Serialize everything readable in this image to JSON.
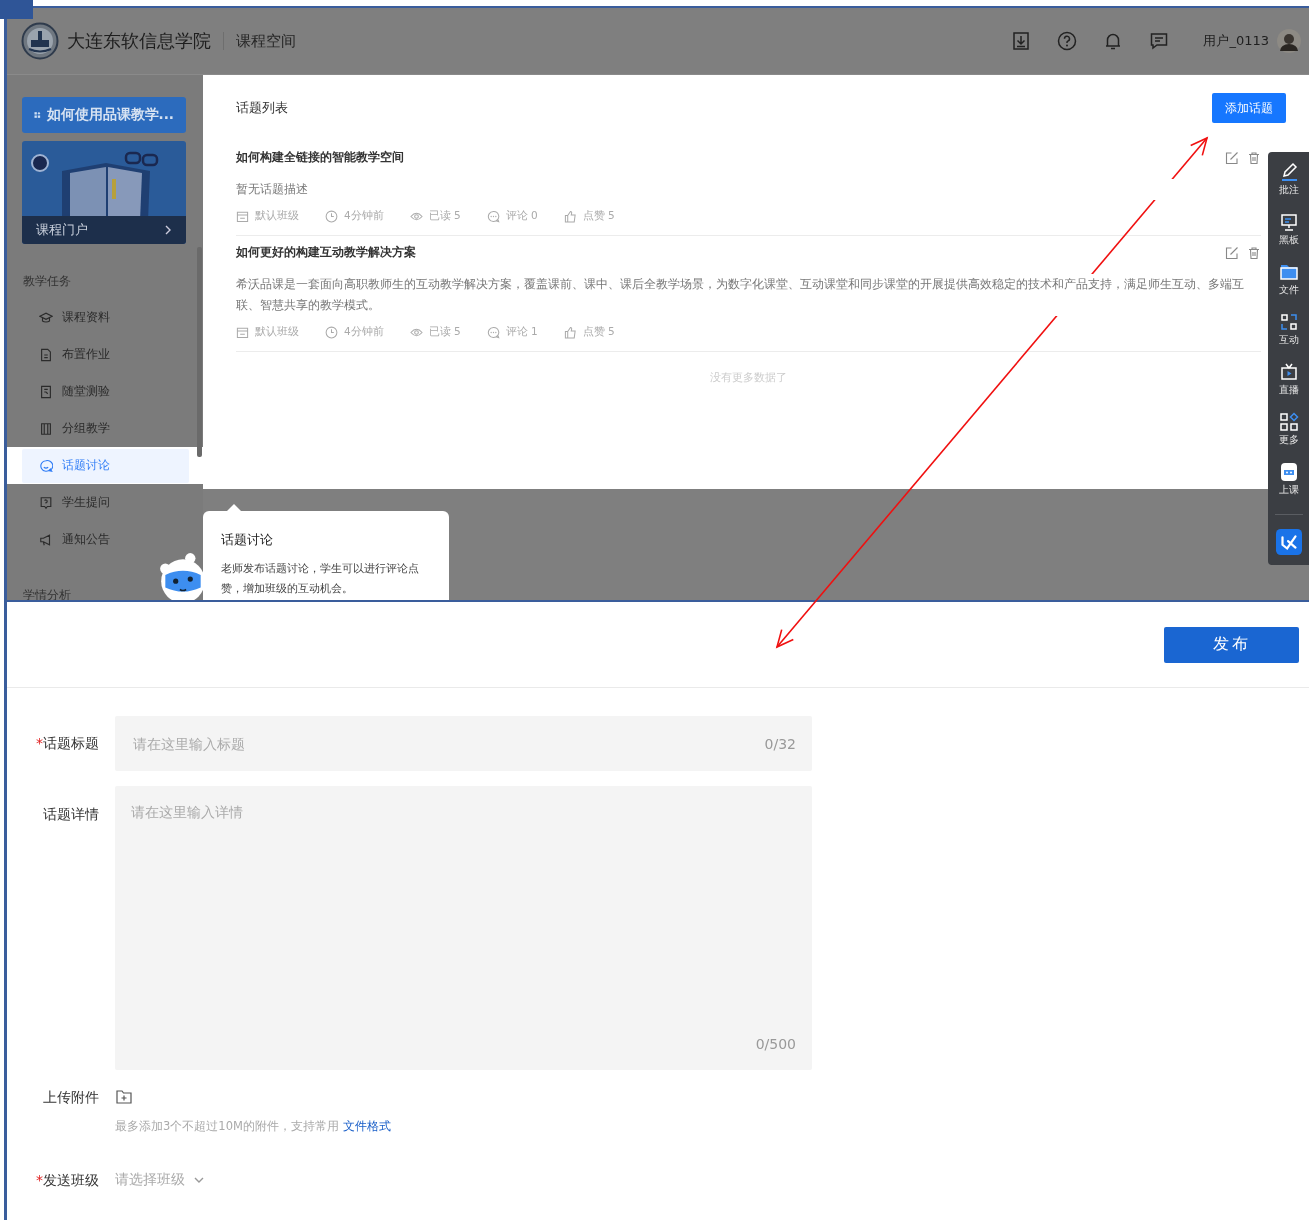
{
  "header": {
    "school": "大连东软信息学院",
    "section": "课程空间",
    "user": "用户_0113"
  },
  "sidebar": {
    "guide_button": "如何使用品课教学...",
    "portal": "课程门户",
    "groups": [
      {
        "title": "教学任务",
        "items": [
          {
            "label": "课程资料",
            "selected": false
          },
          {
            "label": "布置作业",
            "selected": false
          },
          {
            "label": "随堂测验",
            "selected": false
          },
          {
            "label": "分组教学",
            "selected": false
          },
          {
            "label": "话题讨论",
            "selected": true
          },
          {
            "label": "学生提问",
            "selected": false
          },
          {
            "label": "通知公告",
            "selected": false
          }
        ]
      },
      {
        "title": "学情分析"
      }
    ]
  },
  "topic_list": {
    "title": "话题列表",
    "add_button": "添加话题",
    "topics": [
      {
        "title": "如何构建全链接的智能教学空间",
        "description": "暂无话题描述",
        "class": "默认班级",
        "time": "4分钟前",
        "read": "已读 5",
        "comments": "评论 0",
        "likes": "点赞 5"
      },
      {
        "title": "如何更好的构建互动教学解决方案",
        "description": "希沃品课是一套面向高职教师生的互动教学解决方案，覆盖课前、课中、课后全教学场景，为数字化课堂、互动课堂和同步课堂的开展提供高效稳定的技术和产品支持，满足师生互动、多端互联、智慧共享的教学模式。",
        "class": "默认班级",
        "time": "4分钟前",
        "read": "已读 5",
        "comments": "评论 1",
        "likes": "点赞 5"
      }
    ],
    "end_note": "没有更多数据了"
  },
  "toolbar": [
    "批注",
    "黑板",
    "文件",
    "互动",
    "直播",
    "更多",
    "上课"
  ],
  "guide_tooltip": {
    "title": "话题讨论",
    "text": "老师发布话题讨论，学生可以进行评论点赞，增加班级的互动机会。"
  },
  "form": {
    "publish_button": "发布",
    "required_mark": "*",
    "title_field": {
      "label": "话题标题",
      "required": true,
      "placeholder": "请在这里输入标题",
      "counter": "0/32"
    },
    "detail_field": {
      "label": "话题详情",
      "required": false,
      "placeholder": "请在这里输入详情",
      "counter": "0/500"
    },
    "attachment": {
      "label": "上传附件",
      "required": false,
      "hint": "最多添加3个不超过10M的附件，支持常用",
      "link": "文件格式"
    },
    "class_select": {
      "label": "发送班级",
      "required": true,
      "placeholder": "请选择班级"
    }
  }
}
